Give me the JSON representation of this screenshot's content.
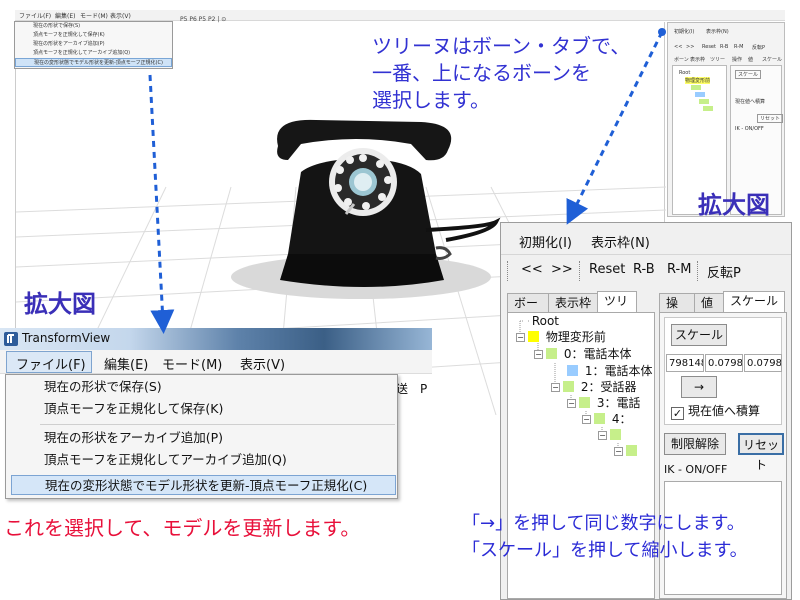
{
  "background": {
    "menubar": [
      "ファイル(F)",
      "編集(E)",
      "モード(M)",
      "表示(V)"
    ],
    "toolbar_text": "P5  P6  P5  P2 | ⊙",
    "dropdown_items": [
      "現在の形状で保存(S)",
      "頂点モーフを正規化して保存(K)",
      "現在の形状をアーカイブ追加(P)",
      "頂点モーフを正規化してアーカイブ追加(Q)",
      "現在の変形状態でモデル形状を更新-頂点モーフ正規化(C)"
    ],
    "right_panel": {
      "menu": [
        "初期化(I)",
        "表示枠(N)"
      ],
      "toolbar": [
        "<<",
        ">>",
        "Reset",
        "R-B",
        "R-M",
        "反転P"
      ],
      "tabs": [
        "ボーン",
        "表示枠",
        "ツリー"
      ],
      "op_tabs": [
        "操作",
        "値",
        "スケール"
      ],
      "tree_root": "Root",
      "tree_item": "物理変形前",
      "scale_button": "スケール",
      "accum_label": "現在値へ積算",
      "reset_button": "リセット",
      "ik_label": "IK - ON/OFF"
    }
  },
  "zoom_right": {
    "menu": [
      "初期化(I)",
      "表示枠(N)"
    ],
    "toolbar": [
      "<<",
      ">>",
      "Reset",
      "R-B",
      "R-M",
      "反転P"
    ],
    "left_tabs": [
      "ボーン",
      "表示枠",
      "ツリー"
    ],
    "right_tabs": [
      "操作",
      "値",
      "スケール"
    ],
    "tree": [
      {
        "label": "Root",
        "color": "#ffffff"
      },
      {
        "label": "物理変形前",
        "color": "#ffff00"
      },
      {
        "label": "0：電話本体",
        "color": "#c6ef8a"
      },
      {
        "label": "1：電話本体",
        "color": "#99ccff"
      },
      {
        "label": "2：受話器",
        "color": "#c6ef8a"
      },
      {
        "label": "3：電話",
        "color": "#c6ef8a"
      },
      {
        "label": "4：",
        "color": "#c6ef8a"
      },
      {
        "label": "",
        "color": "#c6ef8a"
      },
      {
        "label": "",
        "color": "#c6ef8a"
      }
    ],
    "scale_button": "スケール",
    "scale_values": [
      "798148",
      "0.0798",
      "0.0798"
    ],
    "arrow_button": "→",
    "accum_label": "現在値へ積算",
    "accum_checked": "✓",
    "limit_release_button": "制限解除",
    "reset_button": "リセット",
    "ik_label": "IK - ON/OFF"
  },
  "zoom_left": {
    "title": "TransformView",
    "menu": [
      "ファイル(F)",
      "編集(E)",
      "モード(M)",
      "表示(V)"
    ],
    "behind_text": "送　P",
    "dropdown_items": [
      "現在の形状で保存(S)",
      "頂点モーフを正規化して保存(K)",
      "現在の形状をアーカイブ追加(P)",
      "頂点モーフを正規化してアーカイブ追加(Q)",
      "現在の変形状態でモデル形状を更新-頂点モーフ正規化(C)"
    ]
  },
  "annotations": {
    "tree_note": [
      "ツリーヌはボーン・タブで、",
      "一番、上になるボーンを",
      "選択します。"
    ],
    "zoom_right": "拡大図",
    "zoom_left": "拡大図",
    "select_note": "これを選択して、モデルを更新します。",
    "numbers_note": [
      "「→」を押して同じ数字にします。",
      "「スケール」を押して縮小します。"
    ]
  },
  "colors": {
    "annotation_blue": "#3232d2",
    "annotation_red": "#e8103a",
    "arrow_blue": "#1f5fd6",
    "highlight": "#d5e6f8",
    "phone": "#141414"
  }
}
